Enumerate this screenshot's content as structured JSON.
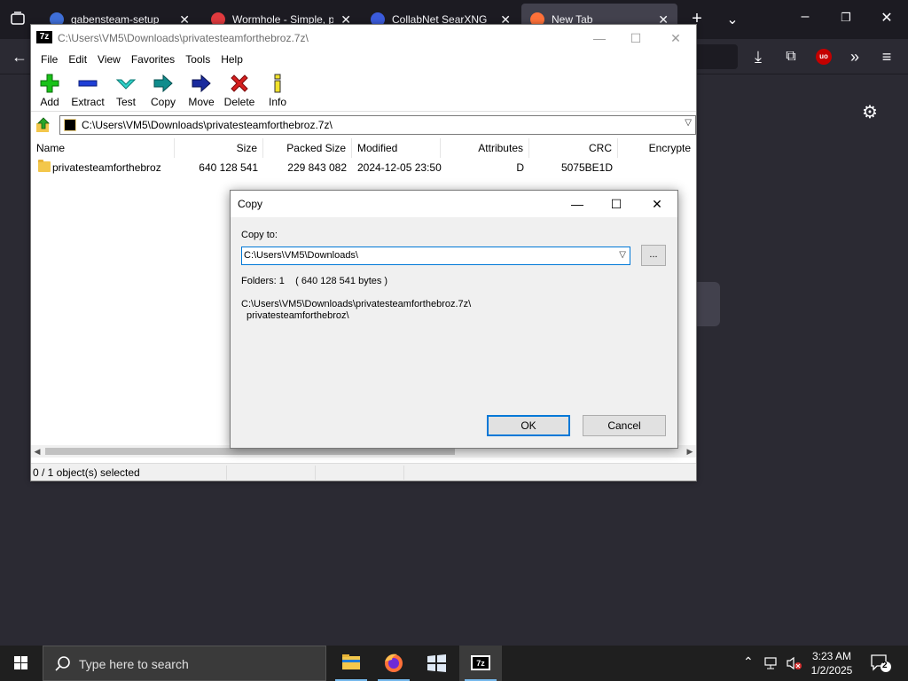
{
  "browser": {
    "tabs": [
      {
        "label": "gabensteam-setup",
        "icon_color": "#3f6fd8"
      },
      {
        "label": "Wormhole - Simple, private",
        "icon_color": "#e03a3e"
      },
      {
        "label": "CollabNet SearXNG",
        "icon_color": "#3b5bdb"
      },
      {
        "label": "New Tab",
        "icon_color": "#ff7139"
      }
    ],
    "colors": {
      "frame": "#1c1b22",
      "toolbar": "#2b2a33",
      "active_tab": "#42414d"
    }
  },
  "fm": {
    "title": "C:\\Users\\VM5\\Downloads\\privatesteamforthebroz.7z\\",
    "app_icon": "7z",
    "menu": [
      "File",
      "Edit",
      "View",
      "Favorites",
      "Tools",
      "Help"
    ],
    "toolbar": [
      "Add",
      "Extract",
      "Test",
      "Copy",
      "Move",
      "Delete",
      "Info"
    ],
    "address": "C:\\Users\\VM5\\Downloads\\privatesteamforthebroz.7z\\",
    "columns": [
      "Name",
      "Size",
      "Packed Size",
      "Modified",
      "Attributes",
      "CRC",
      "Encrypte"
    ],
    "rows": [
      {
        "name": "privatesteamforthebroz",
        "size": "640 128 541",
        "packed": "229 843 082",
        "modified": "2024-12-05 23:50",
        "attributes": "D",
        "crc": "5075BE1D",
        "encrypted": ""
      }
    ],
    "status": "0 / 1 object(s) selected"
  },
  "dialog": {
    "title": "Copy",
    "copy_to_label": "Copy to:",
    "path": "C:\\Users\\VM5\\Downloads\\",
    "browse": "...",
    "summary": "Folders: 1    ( 640 128 541 bytes )",
    "source_line1": "C:\\Users\\VM5\\Downloads\\privatesteamforthebroz.7z\\",
    "source_line2": "privatesteamforthebroz\\",
    "ok": "OK",
    "cancel": "Cancel"
  },
  "taskbar": {
    "search_placeholder": "Type here to search",
    "time": "3:23 AM",
    "date": "1/2/2025",
    "notification_count": "2",
    "apps": [
      "file-explorer-icon",
      "firefox-icon",
      "windows-app-icon",
      "7zip-icon"
    ]
  }
}
